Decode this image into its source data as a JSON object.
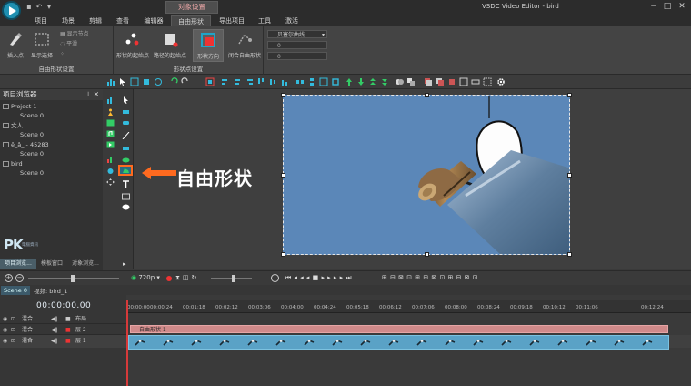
{
  "app": {
    "title": "VSDC Video Editor - bird",
    "context_tab": "对象设置"
  },
  "menu": [
    "项目",
    "场景",
    "剪辑",
    "查看",
    "编辑器",
    "自由形状",
    "导出项目",
    "工具",
    "激活"
  ],
  "ribbon": {
    "group1": {
      "label": "自由形状设置",
      "b1": "插入点",
      "b2": "显示选择",
      "s1": "显示节点",
      "s2": "平滑"
    },
    "group2": {
      "label": "形状点设置",
      "b1": "形状的起始点",
      "b2": "路径的起始点",
      "b3": "形状方向",
      "b4": "闭合自由形状"
    },
    "group3": {
      "combo": "贝塞尔曲线",
      "v1": "0",
      "v2": "0"
    }
  },
  "panel": {
    "title": "项目浏览器",
    "pin": "⊥ ✕",
    "tree": [
      {
        "label": "Project 1",
        "indent": 0
      },
      {
        "label": "Scene 0",
        "indent": 1
      },
      {
        "label": "文人",
        "indent": 0
      },
      {
        "label": "Scene 0",
        "indent": 1
      },
      {
        "label": "ê_â_ - 45283",
        "indent": 0
      },
      {
        "label": "Scene 0",
        "indent": 1
      },
      {
        "label": "bird",
        "indent": 0
      },
      {
        "label": "Scene 0",
        "indent": 1
      }
    ],
    "tabs": [
      "项目浏览...",
      "模板窗口",
      "对象浏览..."
    ],
    "watermark": "PK",
    "watermark_sub": "電腦資訊"
  },
  "annotation": "自由形状",
  "playback": {
    "resolution": "720p"
  },
  "timeline": {
    "scene_tab": "Scene 0",
    "clip_name": "视频: bird_1",
    "timecode": "00:00:00.00",
    "ticks": [
      "00:00:00",
      "00:00:24",
      "00:01:18",
      "00:02:12",
      "00:03:06",
      "00:04:00",
      "00:04:24",
      "00:05:18",
      "00:06:12",
      "00:07:06",
      "00:08:00",
      "00:08:24",
      "00:09:18",
      "00:10:12",
      "00:11:06",
      "00:12:24"
    ],
    "tracks": [
      {
        "blend": "混合...",
        "name": "布局"
      },
      {
        "blend": "混合",
        "name": "层 2"
      },
      {
        "blend": "混合",
        "name": "层 1"
      }
    ],
    "shape_clip": "自由形状 1",
    "video_frames": 19
  },
  "colors": {
    "accent": "#1fa4c8",
    "annotation": "#ff6a1f",
    "shape_clip": "#d08a8a",
    "video_clip": "#5aa2c6",
    "playhead": "#d63a3a"
  }
}
